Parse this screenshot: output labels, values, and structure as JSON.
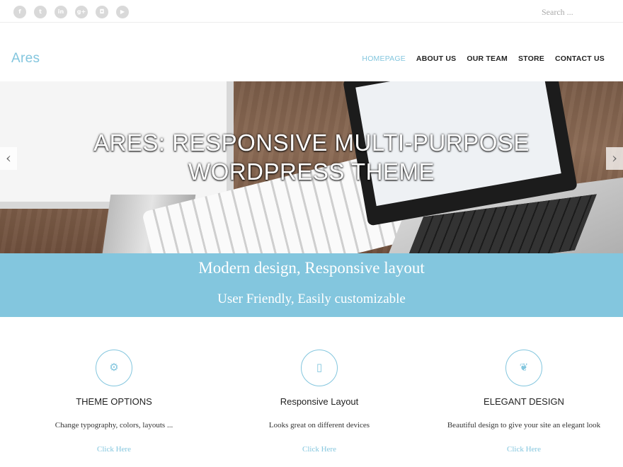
{
  "topbar": {
    "socials": [
      {
        "icon": "facebook-icon",
        "glyph": "f"
      },
      {
        "icon": "twitter-icon",
        "glyph": "t"
      },
      {
        "icon": "linkedin-icon",
        "glyph": "in"
      },
      {
        "icon": "google-plus-icon",
        "glyph": "g+"
      },
      {
        "icon": "instagram-icon",
        "glyph": "◘"
      },
      {
        "icon": "youtube-icon",
        "glyph": "▶"
      }
    ],
    "search_placeholder": "Search ..."
  },
  "header": {
    "logo": "Ares",
    "nav": [
      "HOMEPAGE",
      "ABOUT US",
      "OUR TEAM",
      "STORE",
      "CONTACT US"
    ],
    "active_nav": "HOMEPAGE"
  },
  "hero": {
    "title_line1": "ARES: RESPONSIVE MULTI-PURPOSE",
    "title_line2": "WORDPRESS THEME",
    "prev_arrow": "‹",
    "next_arrow": "›"
  },
  "band": {
    "headline": "Modern design, Responsive layout",
    "subheadline": "User Friendly, Easily customizable"
  },
  "features": [
    {
      "icon": "gears-icon",
      "glyph": "⚙",
      "title": "THEME OPTIONS",
      "desc": "Change typography, colors, layouts ...",
      "link": "Click Here"
    },
    {
      "icon": "mobile-icon",
      "glyph": "▯",
      "title": "Responsive Layout",
      "desc": "Looks great on different devices",
      "link": "Click Here"
    },
    {
      "icon": "leaf-icon",
      "glyph": "❦",
      "title": "ELEGANT DESIGN",
      "desc": "Beautiful design to give your site an elegant look",
      "link": "Click Here"
    }
  ],
  "colors": {
    "accent": "#83c6de",
    "text": "#222222",
    "social_icon_bg": "#d9d9d9"
  }
}
